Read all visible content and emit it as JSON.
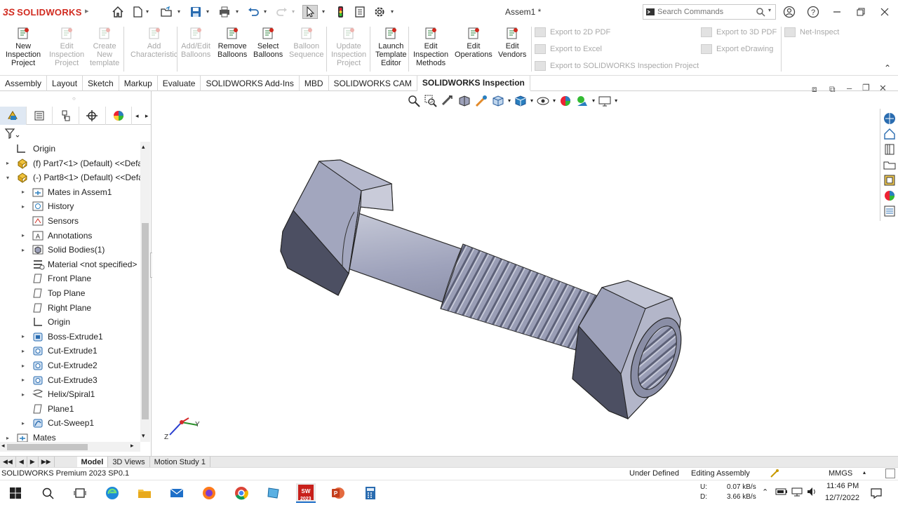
{
  "app": {
    "logo_ds": "3S",
    "logo_name": "SOLIDWORKS",
    "document_title": "Assem1 *",
    "search_placeholder": "Search Commands"
  },
  "commands": [
    {
      "label_lines": [
        "New",
        "Inspection",
        "Project"
      ],
      "enabled": true,
      "icon": "new-project-icon"
    },
    {
      "label_lines": [
        "Edit",
        "Inspection",
        "Project"
      ],
      "enabled": false,
      "icon": "edit-project-icon"
    },
    {
      "label_lines": [
        "Create",
        "New",
        "template"
      ],
      "enabled": false,
      "icon": "create-template-icon"
    },
    {
      "label_lines": [
        "Add",
        "Characteristic"
      ],
      "enabled": false,
      "icon": "add-characteristic-icon"
    },
    {
      "label_lines": [
        "Add/Edit",
        "Balloons"
      ],
      "enabled": false,
      "icon": "balloons-icon"
    },
    {
      "label_lines": [
        "Remove",
        "Balloons"
      ],
      "enabled": true,
      "icon": "remove-balloons-icon"
    },
    {
      "label_lines": [
        "Select",
        "Balloons"
      ],
      "enabled": true,
      "icon": "select-balloons-icon"
    },
    {
      "label_lines": [
        "Balloon",
        "Sequence"
      ],
      "enabled": false,
      "icon": "balloon-sequence-icon"
    },
    {
      "label_lines": [
        "Update",
        "Inspection",
        "Project"
      ],
      "enabled": false,
      "icon": "update-project-icon"
    },
    {
      "label_lines": [
        "Launch",
        "Template",
        "Editor"
      ],
      "enabled": true,
      "icon": "template-editor-icon"
    },
    {
      "label_lines": [
        "Edit",
        "Inspection",
        "Methods"
      ],
      "enabled": true,
      "icon": "inspection-methods-icon"
    },
    {
      "label_lines": [
        "Edit",
        "Operations"
      ],
      "enabled": true,
      "icon": "operations-icon"
    },
    {
      "label_lines": [
        "Edit",
        "Vendors"
      ],
      "enabled": true,
      "icon": "vendors-icon"
    }
  ],
  "export_commands": {
    "export_2d_pdf": "Export to 2D PDF",
    "export_excel": "Export to Excel",
    "export_swi": "Export to SOLIDWORKS Inspection Project",
    "export_3d_pdf": "Export to 3D PDF",
    "export_edrawing": "Export eDrawing",
    "net_inspect": "Net-Inspect"
  },
  "tabs": [
    "Assembly",
    "Layout",
    "Sketch",
    "Markup",
    "Evaluate",
    "SOLIDWORKS Add-Ins",
    "MBD",
    "SOLIDWORKS CAM",
    "SOLIDWORKS Inspection"
  ],
  "active_tab": "SOLIDWORKS Inspection",
  "tree": [
    {
      "label": "Origin",
      "level": 1,
      "expander": "",
      "icon": "origin-icon"
    },
    {
      "label": "(f) Part7<1> (Default) <<Defau",
      "level": 0,
      "expander": "▸",
      "icon": "part-icon"
    },
    {
      "label": "(-) Part8<1> (Default) <<Defau",
      "level": 0,
      "expander": "▾",
      "icon": "part-icon"
    },
    {
      "label": "Mates in Assem1",
      "level": 2,
      "expander": "▸",
      "icon": "mates-folder-icon"
    },
    {
      "label": "History",
      "level": 2,
      "expander": "▸",
      "icon": "history-icon"
    },
    {
      "label": "Sensors",
      "level": 2,
      "expander": "",
      "icon": "sensor-icon"
    },
    {
      "label": "Annotations",
      "level": 2,
      "expander": "▸",
      "icon": "annotations-icon"
    },
    {
      "label": "Solid Bodies(1)",
      "level": 2,
      "expander": "▸",
      "icon": "solid-bodies-icon"
    },
    {
      "label": "Material <not specified>",
      "level": 2,
      "expander": "",
      "icon": "material-icon"
    },
    {
      "label": "Front Plane",
      "level": 2,
      "expander": "",
      "icon": "plane-icon"
    },
    {
      "label": "Top Plane",
      "level": 2,
      "expander": "",
      "icon": "plane-icon"
    },
    {
      "label": "Right Plane",
      "level": 2,
      "expander": "",
      "icon": "plane-icon"
    },
    {
      "label": "Origin",
      "level": 2,
      "expander": "",
      "icon": "origin-icon"
    },
    {
      "label": "Boss-Extrude1",
      "level": 2,
      "expander": "▸",
      "icon": "extrude-icon"
    },
    {
      "label": "Cut-Extrude1",
      "level": 2,
      "expander": "▸",
      "icon": "cut-extrude-icon"
    },
    {
      "label": "Cut-Extrude2",
      "level": 2,
      "expander": "▸",
      "icon": "cut-extrude-icon"
    },
    {
      "label": "Cut-Extrude3",
      "level": 2,
      "expander": "▸",
      "icon": "cut-extrude-icon"
    },
    {
      "label": "Helix/Spiral1",
      "level": 2,
      "expander": "▸",
      "icon": "helix-icon"
    },
    {
      "label": "Plane1",
      "level": 2,
      "expander": "",
      "icon": "plane-icon"
    },
    {
      "label": "Cut-Sweep1",
      "level": 2,
      "expander": "▸",
      "icon": "sweep-icon"
    },
    {
      "label": "Mates",
      "level": 0,
      "expander": "▸",
      "icon": "mates-folder-icon"
    }
  ],
  "triad": {
    "y_label": "Y",
    "z_label": "Z"
  },
  "bottom_tabs": [
    "Model",
    "3D Views",
    "Motion Study 1"
  ],
  "active_bottom_tab": "Model",
  "status": {
    "product": "SOLIDWORKS Premium 2023 SP0.1",
    "definition": "Under Defined",
    "mode": "Editing Assembly",
    "units": "MMGS"
  },
  "taskbar": {
    "net_u_label": "U:",
    "net_d_label": "D:",
    "net_u": "0.07 kB/s",
    "net_d": "3.66 kB/s",
    "time": "11:46 PM",
    "date": "12/7/2022",
    "sw_badge": "2023"
  },
  "colors": {
    "accent_red": "#d12a1f",
    "active_tab_blue": "#dfe8f3",
    "model_gray": "#9da1ba"
  }
}
